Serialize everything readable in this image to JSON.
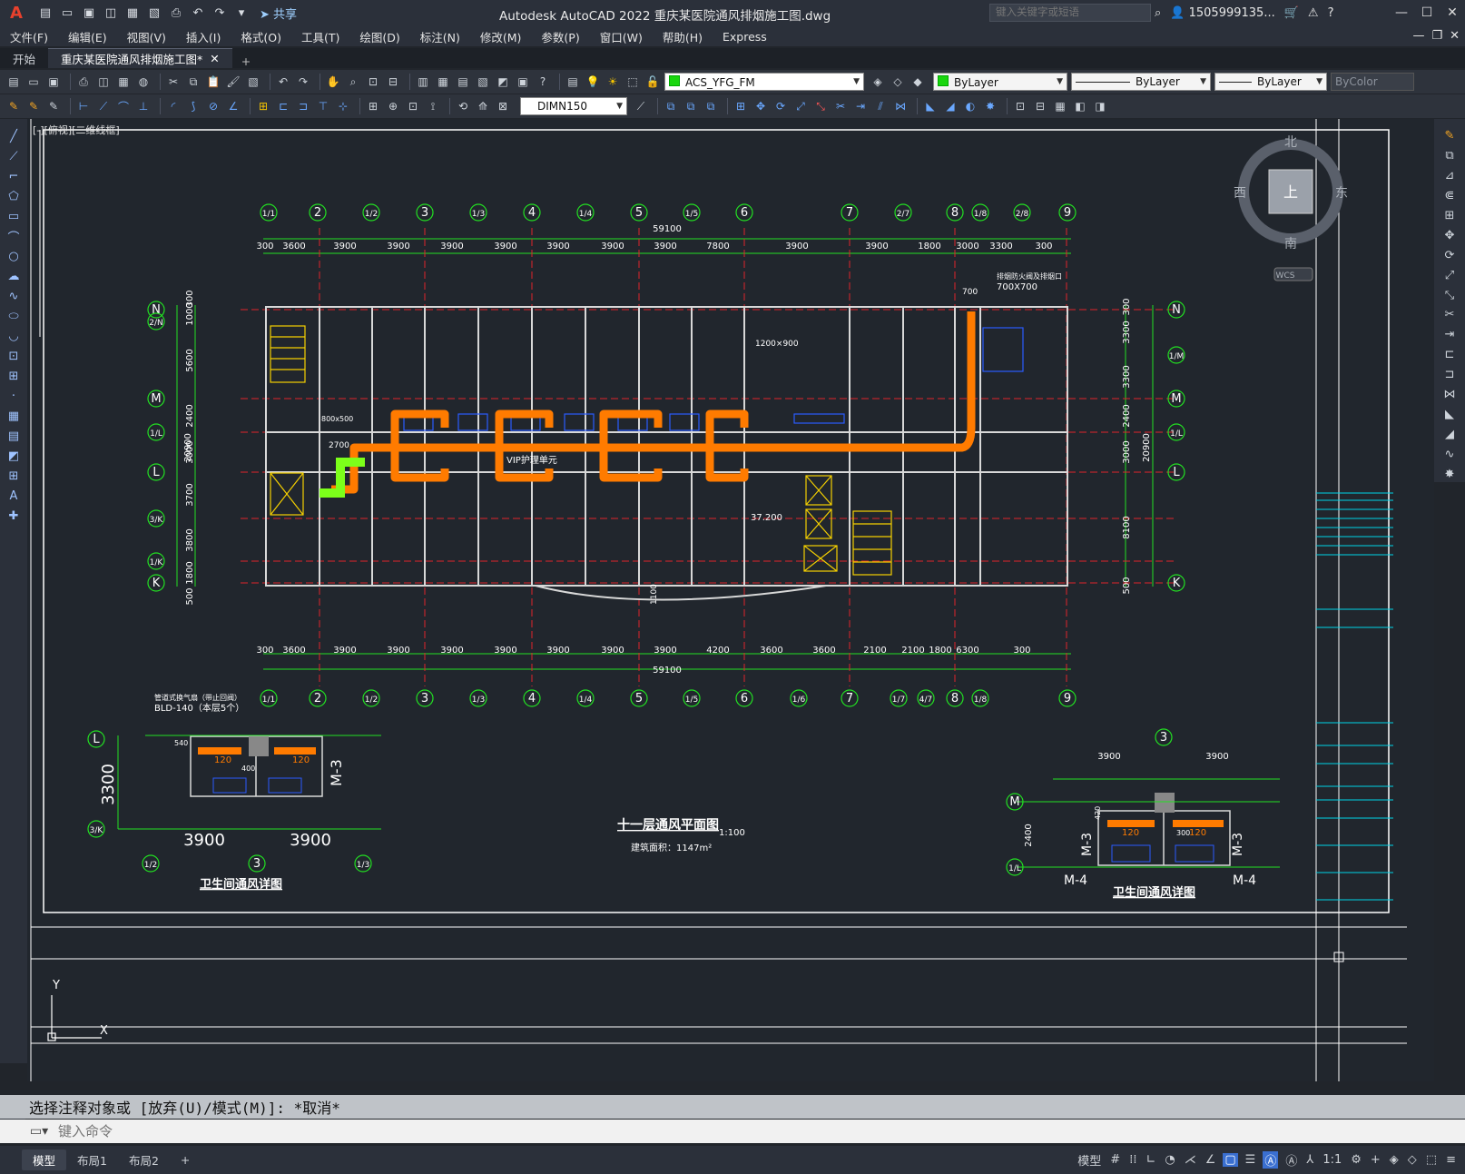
{
  "app": {
    "logo_letter": "A",
    "window_title": "Autodesk AutoCAD 2022    重庆某医院通风排烟施工图.dwg",
    "share_label": "共享",
    "search_placeholder": "键入关键字或短语",
    "user_name": "1505999135...",
    "help_label": "?"
  },
  "menu": [
    "文件(F)",
    "编辑(E)",
    "视图(V)",
    "插入(I)",
    "格式(O)",
    "工具(T)",
    "绘图(D)",
    "标注(N)",
    "修改(M)",
    "参数(P)",
    "窗口(W)",
    "帮助(H)",
    "Express"
  ],
  "file_tabs": [
    {
      "label": "开始",
      "active": false
    },
    {
      "label": "重庆某医院通风排烟施工图*",
      "active": true
    }
  ],
  "toolbar": {
    "layer_name": "ACS_YFG_FM",
    "color_value": "ByLayer",
    "linetype_value": "ByLayer",
    "lineweight_value": "ByLayer",
    "plotstyle_value": "ByColor",
    "dimstyle_value": "DIMN150"
  },
  "viewport": {
    "label": "[-][俯视][二维线框]",
    "viewcube": {
      "north": "北",
      "south": "南",
      "east": "东",
      "west": "西",
      "face": "上",
      "wcs": "WCS"
    }
  },
  "drawing": {
    "plan_title": "十一层通风平面图",
    "plan_scale": "1:100",
    "plan_area": "建筑面积：1147m²",
    "total_dim": "59100",
    "overall_height": "20900",
    "top_axes": [
      "1/1",
      "2",
      "1/2",
      "3",
      "1/3",
      "4",
      "1/4",
      "5",
      "1/5",
      "6",
      "7",
      "2/7",
      "8",
      "1/8",
      "2/8",
      "9"
    ],
    "bottom_axes": [
      "1/1",
      "2",
      "1/2",
      "3",
      "1/3",
      "4",
      "1/4",
      "5",
      "1/5",
      "6",
      "1/6",
      "7",
      "1/7",
      "4/7",
      "8",
      "1/8",
      "9"
    ],
    "top_dims": [
      "300",
      "3600",
      "3900",
      "3900",
      "3900",
      "3900",
      "3900",
      "3900",
      "3900",
      "7800",
      "3900",
      "3900",
      "1800",
      "3000",
      "3300",
      "300"
    ],
    "bottom_dims": [
      "300",
      "3600",
      "3900",
      "3900",
      "3900",
      "3900",
      "3900",
      "3900",
      "3900",
      "4200",
      "3600",
      "3600",
      "2100",
      "2100",
      "1800",
      "6300",
      "300"
    ],
    "left_axes": [
      "N",
      "2/N",
      "M",
      "1/L",
      "L",
      "3/K",
      "1/K",
      "K"
    ],
    "left_dims": [
      "300",
      "1000",
      "5600",
      "2400",
      "3000",
      "3700",
      "3800",
      "1800",
      "500"
    ],
    "right_axes": [
      "N",
      "1/M",
      "M",
      "1/L",
      "L",
      "K"
    ],
    "right_dims": [
      "300",
      "3300",
      "3300",
      "2400",
      "3000",
      "8100",
      "500"
    ],
    "vip_label": "VIP护理单元",
    "duct_notes": [
      "排烟防火阀及排烟口",
      "700X700",
      "700",
      "1200×900",
      "800x500",
      "2700",
      "37.200",
      "1100"
    ],
    "detail_left": {
      "title": "卫生间通风详图",
      "note1": "管道式换气扇（带止回阀）",
      "note2": "BLD-140（本层5个）",
      "dim_v": "3300",
      "dim_h1": "3900",
      "dim_h2": "3900",
      "axes": [
        "L",
        "3/K",
        "1/2",
        "3",
        "1/3"
      ],
      "door": "M-3",
      "small": [
        "540",
        "400",
        "120",
        "120"
      ]
    },
    "detail_right": {
      "title": "卫生间通风详图",
      "dim_h1": "3900",
      "dim_h2": "3900",
      "dim_v": "2400",
      "axes": [
        "3",
        "M",
        "1/L"
      ],
      "doors": [
        "M-4",
        "M-4",
        "M-3",
        "M-3"
      ],
      "small": [
        "420",
        "300",
        "120",
        "120"
      ]
    },
    "ucs_x": "X",
    "ucs_y": "Y"
  },
  "command": {
    "history": "选择注释对象或 [放弃(U)/模式(M)]: *取消*",
    "placeholder": "键入命令"
  },
  "status": {
    "layout_tabs": [
      {
        "label": "模型",
        "active": true
      },
      {
        "label": "布局1",
        "active": false
      },
      {
        "label": "布局2",
        "active": false
      }
    ],
    "model_label": "模型",
    "scale_label": "1:1"
  }
}
